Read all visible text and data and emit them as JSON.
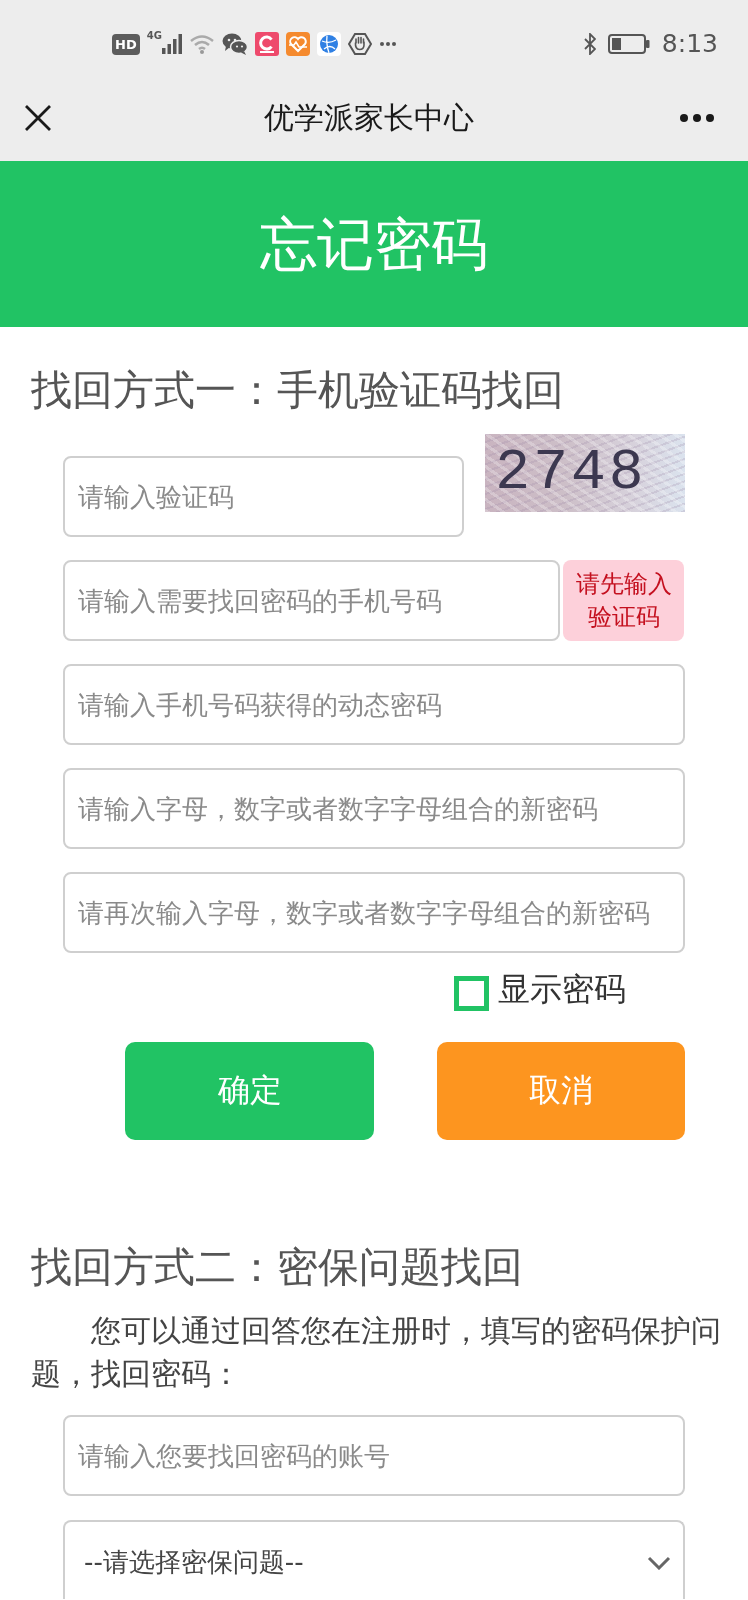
{
  "status_bar": {
    "hd_label": "HD",
    "network_label": "4G",
    "time": "8:13"
  },
  "nav_bar": {
    "title": "优学派家长中心"
  },
  "header": {
    "title": "忘记密码"
  },
  "method_one": {
    "heading": "找回方式一：手机验证码找回",
    "captcha_field": {
      "placeholder": "请输入验证码"
    },
    "captcha": {
      "code": "2748"
    },
    "phone_field": {
      "placeholder": "请输入需要找回密码的手机号码"
    },
    "sms_button": {
      "label": "请先输入验证码",
      "disabled": true
    },
    "sms_code_field": {
      "placeholder": "请输入手机号码获得的动态密码"
    },
    "new_password_field": {
      "placeholder": "请输入字母，数字或者数字字母组合的新密码"
    },
    "repeat_password_field": {
      "placeholder": "请再次输入字母，数字或者数字字母组合的新密码"
    },
    "show_password": {
      "label": "显示密码",
      "checked": false
    },
    "buttons": [
      {
        "label": "确定",
        "kind": "confirm"
      },
      {
        "label": "取消",
        "kind": "cancel"
      }
    ]
  },
  "method_two": {
    "heading": "找回方式二：密保问题找回",
    "intro": "您可以通过回答您在注册时，填写的密码保护问题，找回密码：",
    "account_field": {
      "placeholder": "请输入您要找回密码的账号"
    },
    "question_select": {
      "value": "--请选择密保问题--"
    }
  }
}
